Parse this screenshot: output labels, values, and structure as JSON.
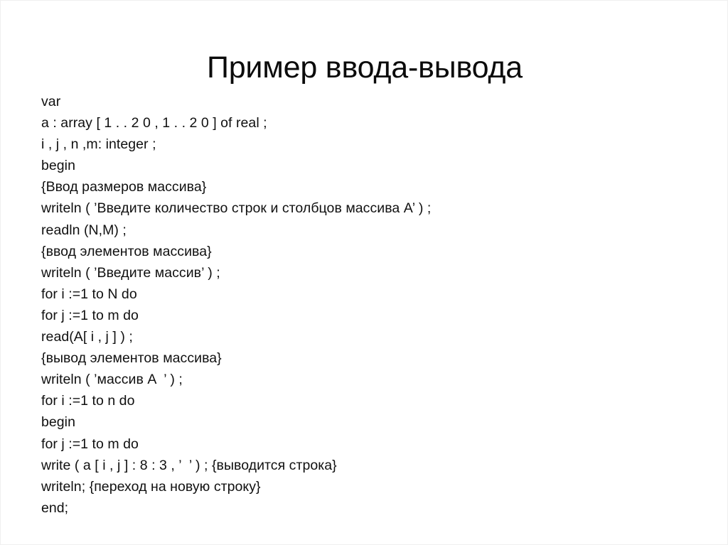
{
  "slide": {
    "title": "Пример ввода-вывода",
    "background_color": "#ffffff",
    "text_color": "#101010",
    "language": "ru",
    "code_listing_language": "Pascal"
  },
  "code": {
    "lines": [
      "var",
      "a : array [ 1 . . 2 0 , 1 . . 2 0 ] of real ;",
      "i , j , n ,m: integer ;",
      "begin",
      "{Ввод размеров массива}",
      "writeln ( ’Введите количество строк и столбцов массива А’ ) ;",
      "readln (N,M) ;",
      "{ввод элементов массива}",
      "writeln ( ’Введите массив’ ) ;",
      "for i :=1 to N do",
      "for j :=1 to m do",
      "read(A[ i , j ] ) ;",
      "{вывод элементов массива}",
      "writeln ( ’массив A  ’ ) ;",
      "for i :=1 to n do",
      "begin",
      "for j :=1 to m do",
      "write ( a [ i , j ] : 8 : 3 , ’  ’ ) ; {выводится строка}",
      "writeln; {переход на новую строку}",
      "end;"
    ]
  }
}
